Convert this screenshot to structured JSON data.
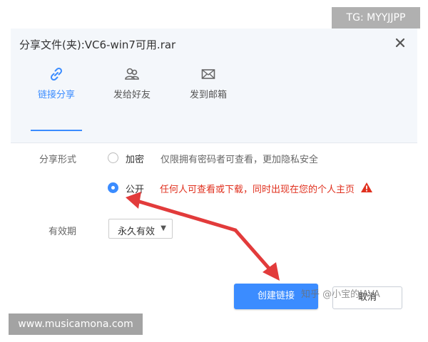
{
  "dialog": {
    "title": "分享文件(夹):VC6-win7可用.rar",
    "tabs": [
      {
        "label": "链接分享",
        "icon": "link-icon",
        "active": true
      },
      {
        "label": "发给好友",
        "icon": "friends-icon",
        "active": false
      },
      {
        "label": "发到邮箱",
        "icon": "mail-icon",
        "active": false
      }
    ]
  },
  "form": {
    "share_type_label": "分享形式",
    "options": [
      {
        "label": "加密",
        "desc": "仅限拥有密码者可查看，更加隐私安全",
        "checked": false
      },
      {
        "label": "公开",
        "desc": "任何人可查看或下载，同时出现在您的个人主页",
        "checked": true
      }
    ],
    "validity_label": "有效期",
    "validity_value": "永久有效"
  },
  "buttons": {
    "create": "创建链接",
    "cancel": "取消"
  },
  "watermarks": {
    "zhihu": "知乎 @小宝的JAVA",
    "tg": "TG: MYYJJPP",
    "site": "www.musicamona.com"
  },
  "colors": {
    "accent": "#3b8cff",
    "warning": "#e0301e",
    "arrow": "#e23b3b"
  }
}
